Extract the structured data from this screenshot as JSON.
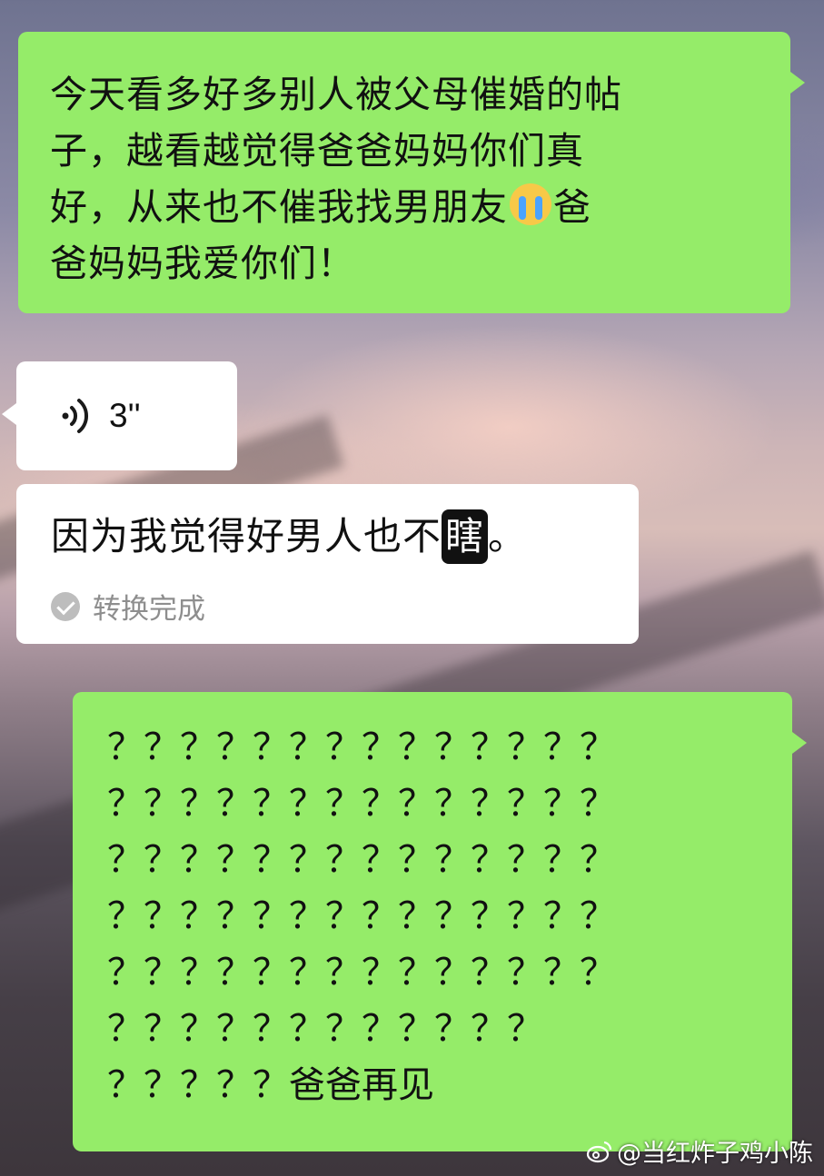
{
  "chat": {
    "message_1": {
      "line1": "今天看多好多别人被父母催婚的帖",
      "line2": "子，越看越觉得爸爸妈妈你们真",
      "line3_before_emoji": "好，从来也不催我找男朋友",
      "emoji": "crying-face-emoji",
      "line3_after_emoji": "爸",
      "line4": "爸妈妈我爱你们！"
    },
    "voice_message": {
      "icon": "voice-wave-icon",
      "duration": "3''"
    },
    "voice_transcript": {
      "text_before": "因为我觉得好男人也不",
      "highlighted_char": "瞎",
      "text_after": "。",
      "status": "转换完成",
      "status_icon": "check-circle-icon"
    },
    "message_2": {
      "rows": [
        "？？？？？？？？？？？？？？",
        "？？？？？？？？？？？？？？",
        "？？？？？？？？？？？？？？",
        "？？？？？？？？？？？？？？",
        "？？？？？？？？？？？？？？",
        "？？？？？？？？？？？？"
      ],
      "last_row_marks": "？？？？？",
      "last_row_text": "爸爸再见"
    }
  },
  "watermark": {
    "icon": "weibo-icon",
    "text": "@当红炸子鸡小陈"
  },
  "colors": {
    "outgoing_bubble": "#95ec69",
    "incoming_bubble": "#ffffff",
    "status_gray": "#8e8e8e"
  }
}
